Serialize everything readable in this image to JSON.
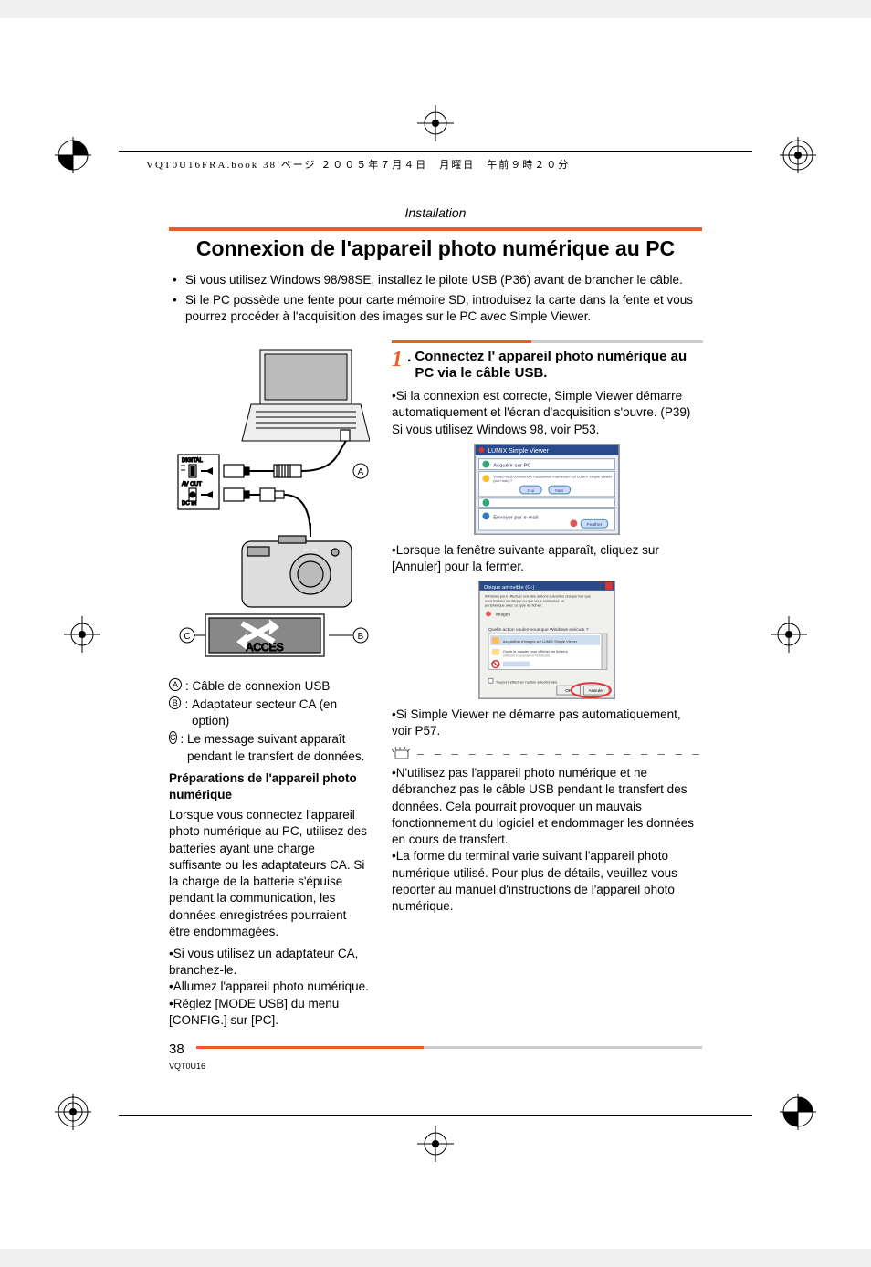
{
  "header_text": "VQT0U16FRA.book  38 ページ  ２００５年７月４日　月曜日　午前９時２０分",
  "section_header": "Installation",
  "main_title": "Connexion de l'appareil photo numérique au PC",
  "intro": [
    "Si vous utilisez Windows 98/98SE, installez le pilote USB (P36) avant de brancher le câble.",
    "Si le PC possède une fente pour carte mémoire SD, introduisez la carte dans la fente et vous pourrez procéder à l'acquisition des images sur le PC avec Simple Viewer."
  ],
  "diagram_labels": {
    "digital": "DIGITAL",
    "av_out": "AV OUT",
    "dc_in": "DC IN",
    "acces": "ACCES",
    "A": "A",
    "B": "B",
    "C": "C"
  },
  "legend": {
    "A": "Câble de connexion USB",
    "B": "Adaptateur secteur CA (en option)",
    "C": "Le message suivant apparaît pendant le transfert de données."
  },
  "prep_heading": "Préparations de l'appareil photo numérique",
  "prep_body": "Lorsque vous connectez l'appareil photo numérique au PC, utilisez des batteries ayant une charge suffisante ou les adaptateurs CA. Si la charge de la batterie s'épuise pendant la communication, les données enregistrées pourraient être endommagées.",
  "prep_bullets": [
    "Si vous utilisez un adaptateur CA, branchez-le.",
    "Allumez l'appareil photo numérique.",
    "Réglez [MODE USB] du menu [CONFIG.] sur [PC]."
  ],
  "step": {
    "num": "1",
    "title": "Connectez l' appareil photo numérique au PC via le câble USB.",
    "body1": "Si la connexion est correcte, Simple Viewer démarre automatiquement et l'écran d'acquisition s'ouvre. (P39) Si vous utilisez Windows 98, voir P53.",
    "shot1_title": "LUMIX Simple Viewer",
    "shot1_row1": "Acquérir sur PC",
    "shot1_prompt": "Voulez-vous commencer l'acquisition maintenant sur LUMIX Simple Viewer (oui / non) ?",
    "shot1_btn_oui": "Oui",
    "shot1_btn_non": "Non",
    "shot1_row3": "Envoyer par e-mail",
    "shot1_feather": "Feather",
    "body2": "Lorsque la fenêtre suivante apparaît, cliquez sur [Annuler] pour la fermer.",
    "shot2_title": "Disque amovible (G:)",
    "shot2_msg": "Windows peut effectuer une des actions suivantes chaque fois que vous insérez un disque ou que vous connectez un périphérique avec ce type de fichier :",
    "shot2_images": "Images",
    "shot2_q": "Quelle action voulez-vous que Windows exécute ?",
    "shot2_opt1": "Acquisition d'images sur LUMIX Simple Viewer",
    "shot2_opt2": "Ouvrir le dossier pour afficher les fichiers utilisant Explorateur Windows",
    "shot2_chk": "Toujours effectuer l'action sélectionnée.",
    "shot2_ok": "OK",
    "shot2_cancel": "Annuler",
    "body3": "Si Simple Viewer ne démarre pas automatiquement, voir P57."
  },
  "notes": [
    "N'utilisez pas l'appareil photo numérique et ne débranchez pas le câble USB pendant le transfert des données. Cela pourrait provoquer un mauvais fonctionnement du logiciel et endommager les données en cours de transfert.",
    "La forme du terminal varie suivant l'appareil photo numérique utilisé. Pour plus de détails, veuillez vous reporter au manuel d'instructions de l'appareil photo numérique."
  ],
  "page_number": "38",
  "doc_code": "VQT0U16"
}
